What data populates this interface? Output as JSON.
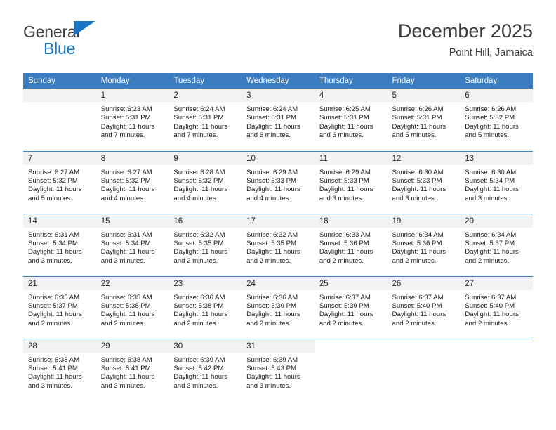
{
  "brand": {
    "line1": "General",
    "line2": "Blue",
    "accent_color": "#1876c4",
    "logo_icon": "triangle-icon"
  },
  "header": {
    "title": "December 2025",
    "subtitle": "Point Hill, Jamaica",
    "header_bg_color": "#3b7dc0",
    "daynum_band_color": "#f2f2f2"
  },
  "weekdays": [
    "Sunday",
    "Monday",
    "Tuesday",
    "Wednesday",
    "Thursday",
    "Friday",
    "Saturday"
  ],
  "weeks": [
    [
      {
        "day": "",
        "sunrise": "",
        "sunset": "",
        "daylight1": "",
        "daylight2": "",
        "empty": true
      },
      {
        "day": "1",
        "sunrise": "Sunrise: 6:23 AM",
        "sunset": "Sunset: 5:31 PM",
        "daylight1": "Daylight: 11 hours",
        "daylight2": "and 7 minutes."
      },
      {
        "day": "2",
        "sunrise": "Sunrise: 6:24 AM",
        "sunset": "Sunset: 5:31 PM",
        "daylight1": "Daylight: 11 hours",
        "daylight2": "and 7 minutes."
      },
      {
        "day": "3",
        "sunrise": "Sunrise: 6:24 AM",
        "sunset": "Sunset: 5:31 PM",
        "daylight1": "Daylight: 11 hours",
        "daylight2": "and 6 minutes."
      },
      {
        "day": "4",
        "sunrise": "Sunrise: 6:25 AM",
        "sunset": "Sunset: 5:31 PM",
        "daylight1": "Daylight: 11 hours",
        "daylight2": "and 6 minutes."
      },
      {
        "day": "5",
        "sunrise": "Sunrise: 6:26 AM",
        "sunset": "Sunset: 5:31 PM",
        "daylight1": "Daylight: 11 hours",
        "daylight2": "and 5 minutes."
      },
      {
        "day": "6",
        "sunrise": "Sunrise: 6:26 AM",
        "sunset": "Sunset: 5:32 PM",
        "daylight1": "Daylight: 11 hours",
        "daylight2": "and 5 minutes."
      }
    ],
    [
      {
        "day": "7",
        "sunrise": "Sunrise: 6:27 AM",
        "sunset": "Sunset: 5:32 PM",
        "daylight1": "Daylight: 11 hours",
        "daylight2": "and 5 minutes."
      },
      {
        "day": "8",
        "sunrise": "Sunrise: 6:27 AM",
        "sunset": "Sunset: 5:32 PM",
        "daylight1": "Daylight: 11 hours",
        "daylight2": "and 4 minutes."
      },
      {
        "day": "9",
        "sunrise": "Sunrise: 6:28 AM",
        "sunset": "Sunset: 5:32 PM",
        "daylight1": "Daylight: 11 hours",
        "daylight2": "and 4 minutes."
      },
      {
        "day": "10",
        "sunrise": "Sunrise: 6:29 AM",
        "sunset": "Sunset: 5:33 PM",
        "daylight1": "Daylight: 11 hours",
        "daylight2": "and 4 minutes."
      },
      {
        "day": "11",
        "sunrise": "Sunrise: 6:29 AM",
        "sunset": "Sunset: 5:33 PM",
        "daylight1": "Daylight: 11 hours",
        "daylight2": "and 3 minutes."
      },
      {
        "day": "12",
        "sunrise": "Sunrise: 6:30 AM",
        "sunset": "Sunset: 5:33 PM",
        "daylight1": "Daylight: 11 hours",
        "daylight2": "and 3 minutes."
      },
      {
        "day": "13",
        "sunrise": "Sunrise: 6:30 AM",
        "sunset": "Sunset: 5:34 PM",
        "daylight1": "Daylight: 11 hours",
        "daylight2": "and 3 minutes."
      }
    ],
    [
      {
        "day": "14",
        "sunrise": "Sunrise: 6:31 AM",
        "sunset": "Sunset: 5:34 PM",
        "daylight1": "Daylight: 11 hours",
        "daylight2": "and 3 minutes."
      },
      {
        "day": "15",
        "sunrise": "Sunrise: 6:31 AM",
        "sunset": "Sunset: 5:34 PM",
        "daylight1": "Daylight: 11 hours",
        "daylight2": "and 3 minutes."
      },
      {
        "day": "16",
        "sunrise": "Sunrise: 6:32 AM",
        "sunset": "Sunset: 5:35 PM",
        "daylight1": "Daylight: 11 hours",
        "daylight2": "and 2 minutes."
      },
      {
        "day": "17",
        "sunrise": "Sunrise: 6:32 AM",
        "sunset": "Sunset: 5:35 PM",
        "daylight1": "Daylight: 11 hours",
        "daylight2": "and 2 minutes."
      },
      {
        "day": "18",
        "sunrise": "Sunrise: 6:33 AM",
        "sunset": "Sunset: 5:36 PM",
        "daylight1": "Daylight: 11 hours",
        "daylight2": "and 2 minutes."
      },
      {
        "day": "19",
        "sunrise": "Sunrise: 6:34 AM",
        "sunset": "Sunset: 5:36 PM",
        "daylight1": "Daylight: 11 hours",
        "daylight2": "and 2 minutes."
      },
      {
        "day": "20",
        "sunrise": "Sunrise: 6:34 AM",
        "sunset": "Sunset: 5:37 PM",
        "daylight1": "Daylight: 11 hours",
        "daylight2": "and 2 minutes."
      }
    ],
    [
      {
        "day": "21",
        "sunrise": "Sunrise: 6:35 AM",
        "sunset": "Sunset: 5:37 PM",
        "daylight1": "Daylight: 11 hours",
        "daylight2": "and 2 minutes."
      },
      {
        "day": "22",
        "sunrise": "Sunrise: 6:35 AM",
        "sunset": "Sunset: 5:38 PM",
        "daylight1": "Daylight: 11 hours",
        "daylight2": "and 2 minutes."
      },
      {
        "day": "23",
        "sunrise": "Sunrise: 6:36 AM",
        "sunset": "Sunset: 5:38 PM",
        "daylight1": "Daylight: 11 hours",
        "daylight2": "and 2 minutes."
      },
      {
        "day": "24",
        "sunrise": "Sunrise: 6:36 AM",
        "sunset": "Sunset: 5:39 PM",
        "daylight1": "Daylight: 11 hours",
        "daylight2": "and 2 minutes."
      },
      {
        "day": "25",
        "sunrise": "Sunrise: 6:37 AM",
        "sunset": "Sunset: 5:39 PM",
        "daylight1": "Daylight: 11 hours",
        "daylight2": "and 2 minutes."
      },
      {
        "day": "26",
        "sunrise": "Sunrise: 6:37 AM",
        "sunset": "Sunset: 5:40 PM",
        "daylight1": "Daylight: 11 hours",
        "daylight2": "and 2 minutes."
      },
      {
        "day": "27",
        "sunrise": "Sunrise: 6:37 AM",
        "sunset": "Sunset: 5:40 PM",
        "daylight1": "Daylight: 11 hours",
        "daylight2": "and 2 minutes."
      }
    ],
    [
      {
        "day": "28",
        "sunrise": "Sunrise: 6:38 AM",
        "sunset": "Sunset: 5:41 PM",
        "daylight1": "Daylight: 11 hours",
        "daylight2": "and 3 minutes."
      },
      {
        "day": "29",
        "sunrise": "Sunrise: 6:38 AM",
        "sunset": "Sunset: 5:41 PM",
        "daylight1": "Daylight: 11 hours",
        "daylight2": "and 3 minutes."
      },
      {
        "day": "30",
        "sunrise": "Sunrise: 6:39 AM",
        "sunset": "Sunset: 5:42 PM",
        "daylight1": "Daylight: 11 hours",
        "daylight2": "and 3 minutes."
      },
      {
        "day": "31",
        "sunrise": "Sunrise: 6:39 AM",
        "sunset": "Sunset: 5:43 PM",
        "daylight1": "Daylight: 11 hours",
        "daylight2": "and 3 minutes."
      },
      {
        "day": "",
        "sunrise": "",
        "sunset": "",
        "daylight1": "",
        "daylight2": "",
        "blank": true
      },
      {
        "day": "",
        "sunrise": "",
        "sunset": "",
        "daylight1": "",
        "daylight2": "",
        "blank": true
      },
      {
        "day": "",
        "sunrise": "",
        "sunset": "",
        "daylight1": "",
        "daylight2": "",
        "blank": true
      }
    ]
  ]
}
